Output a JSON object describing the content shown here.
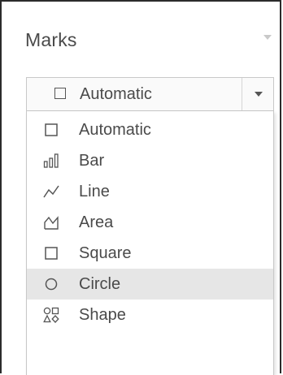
{
  "panel": {
    "title": "Marks"
  },
  "mark_type_select": {
    "value": "Automatic",
    "icon": "square-icon"
  },
  "menu": {
    "items": [
      {
        "label": "Automatic",
        "icon": "square-icon",
        "selected": false
      },
      {
        "label": "Bar",
        "icon": "bar-chart-icon",
        "selected": false
      },
      {
        "label": "Line",
        "icon": "line-chart-icon",
        "selected": false
      },
      {
        "label": "Area",
        "icon": "area-chart-icon",
        "selected": false
      },
      {
        "label": "Square",
        "icon": "square-icon",
        "selected": false
      },
      {
        "label": "Circle",
        "icon": "circle-icon",
        "selected": true
      },
      {
        "label": "Shape",
        "icon": "shapes-icon",
        "selected": false
      }
    ]
  },
  "colors": {
    "highlight": "#e6e6e6",
    "text": "#4a4a4a",
    "frame": "#2b2b2b"
  }
}
